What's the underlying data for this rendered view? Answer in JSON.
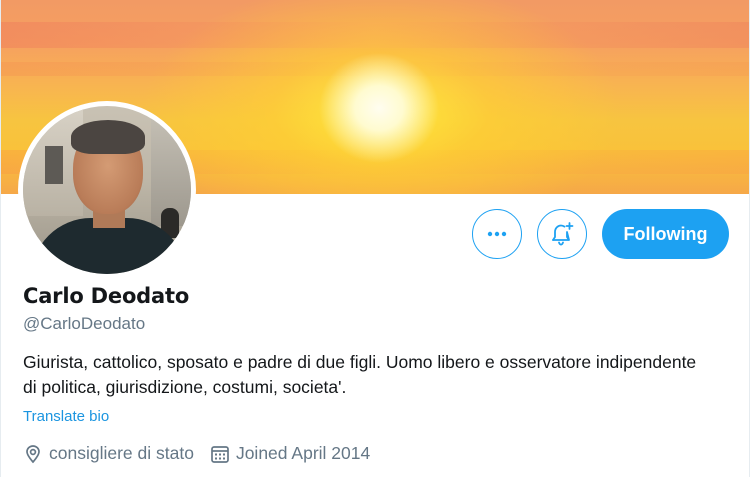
{
  "profile": {
    "name": "Carlo Deodato",
    "handle": "@CarloDeodato",
    "bio": "Giurista, cattolico, sposato e padre di due figli. Uomo libero e osservatore indipendente di politica, giurisdizione, costumi, societa'.",
    "translate_label": "Translate bio",
    "location": "consigliere di stato",
    "joined": "Joined April 2014"
  },
  "actions": {
    "more_icon": "more-horizontal-icon",
    "notify_icon": "bell-plus-icon",
    "follow_label": "Following"
  },
  "colors": {
    "accent": "#1da1f2",
    "link": "#1b95e0",
    "secondary_text": "#657786",
    "primary_text": "#14171a"
  }
}
